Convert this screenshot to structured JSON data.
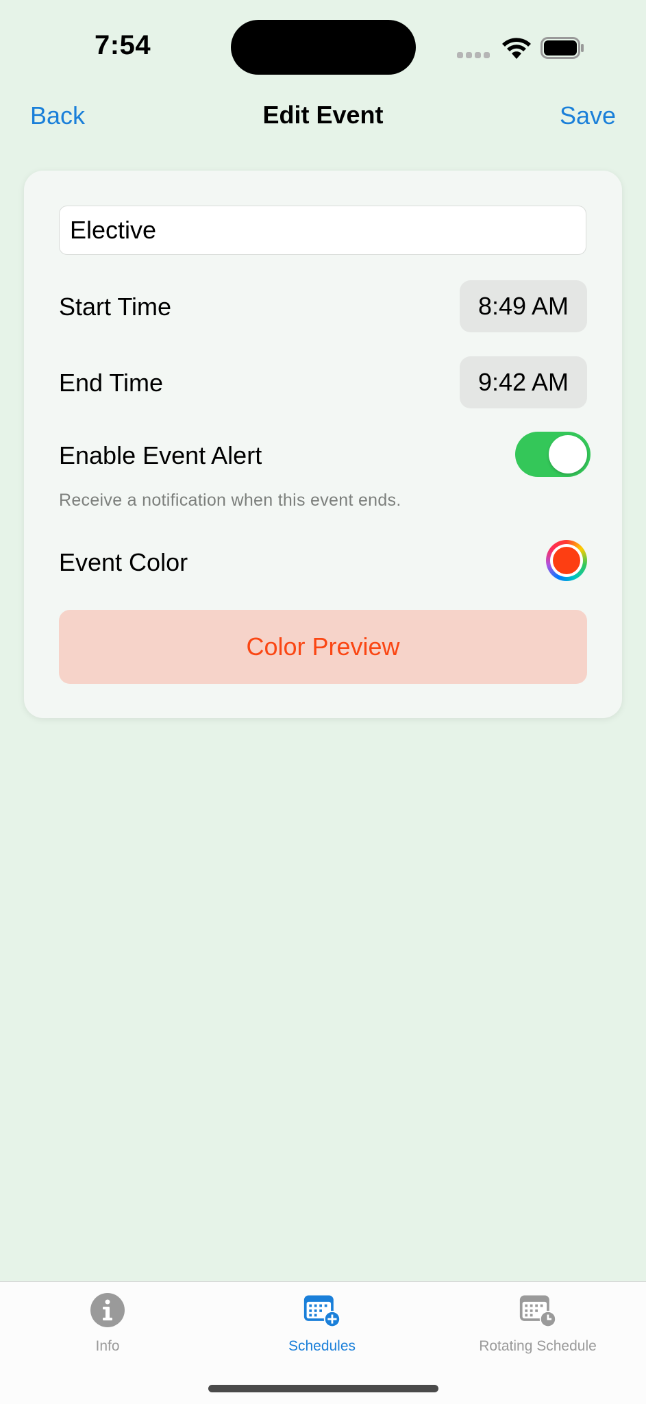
{
  "status_bar": {
    "time": "7:54"
  },
  "nav": {
    "back_label": "Back",
    "title": "Edit Event",
    "save_label": "Save"
  },
  "form": {
    "event_name": "Elective",
    "start_time_label": "Start Time",
    "start_time_value": "8:49 AM",
    "end_time_label": "End Time",
    "end_time_value": "9:42 AM",
    "alert_label": "Enable Event Alert",
    "alert_enabled": true,
    "alert_hint": "Receive a notification when this event ends.",
    "color_label": "Event Color",
    "event_color": "#fd3e12",
    "preview_label": "Color Preview"
  },
  "tabs": [
    {
      "label": "Info",
      "icon": "info-circle-icon",
      "active": false
    },
    {
      "label": "Schedules",
      "icon": "calendar-add-icon",
      "active": true
    },
    {
      "label": "Rotating Schedule",
      "icon": "calendar-clock-icon",
      "active": false
    }
  ],
  "colors": {
    "accent": "#1a7fd9",
    "toggle_on": "#34c759",
    "background": "#e6f3e8",
    "inactive_tab": "#9a9a9a"
  }
}
